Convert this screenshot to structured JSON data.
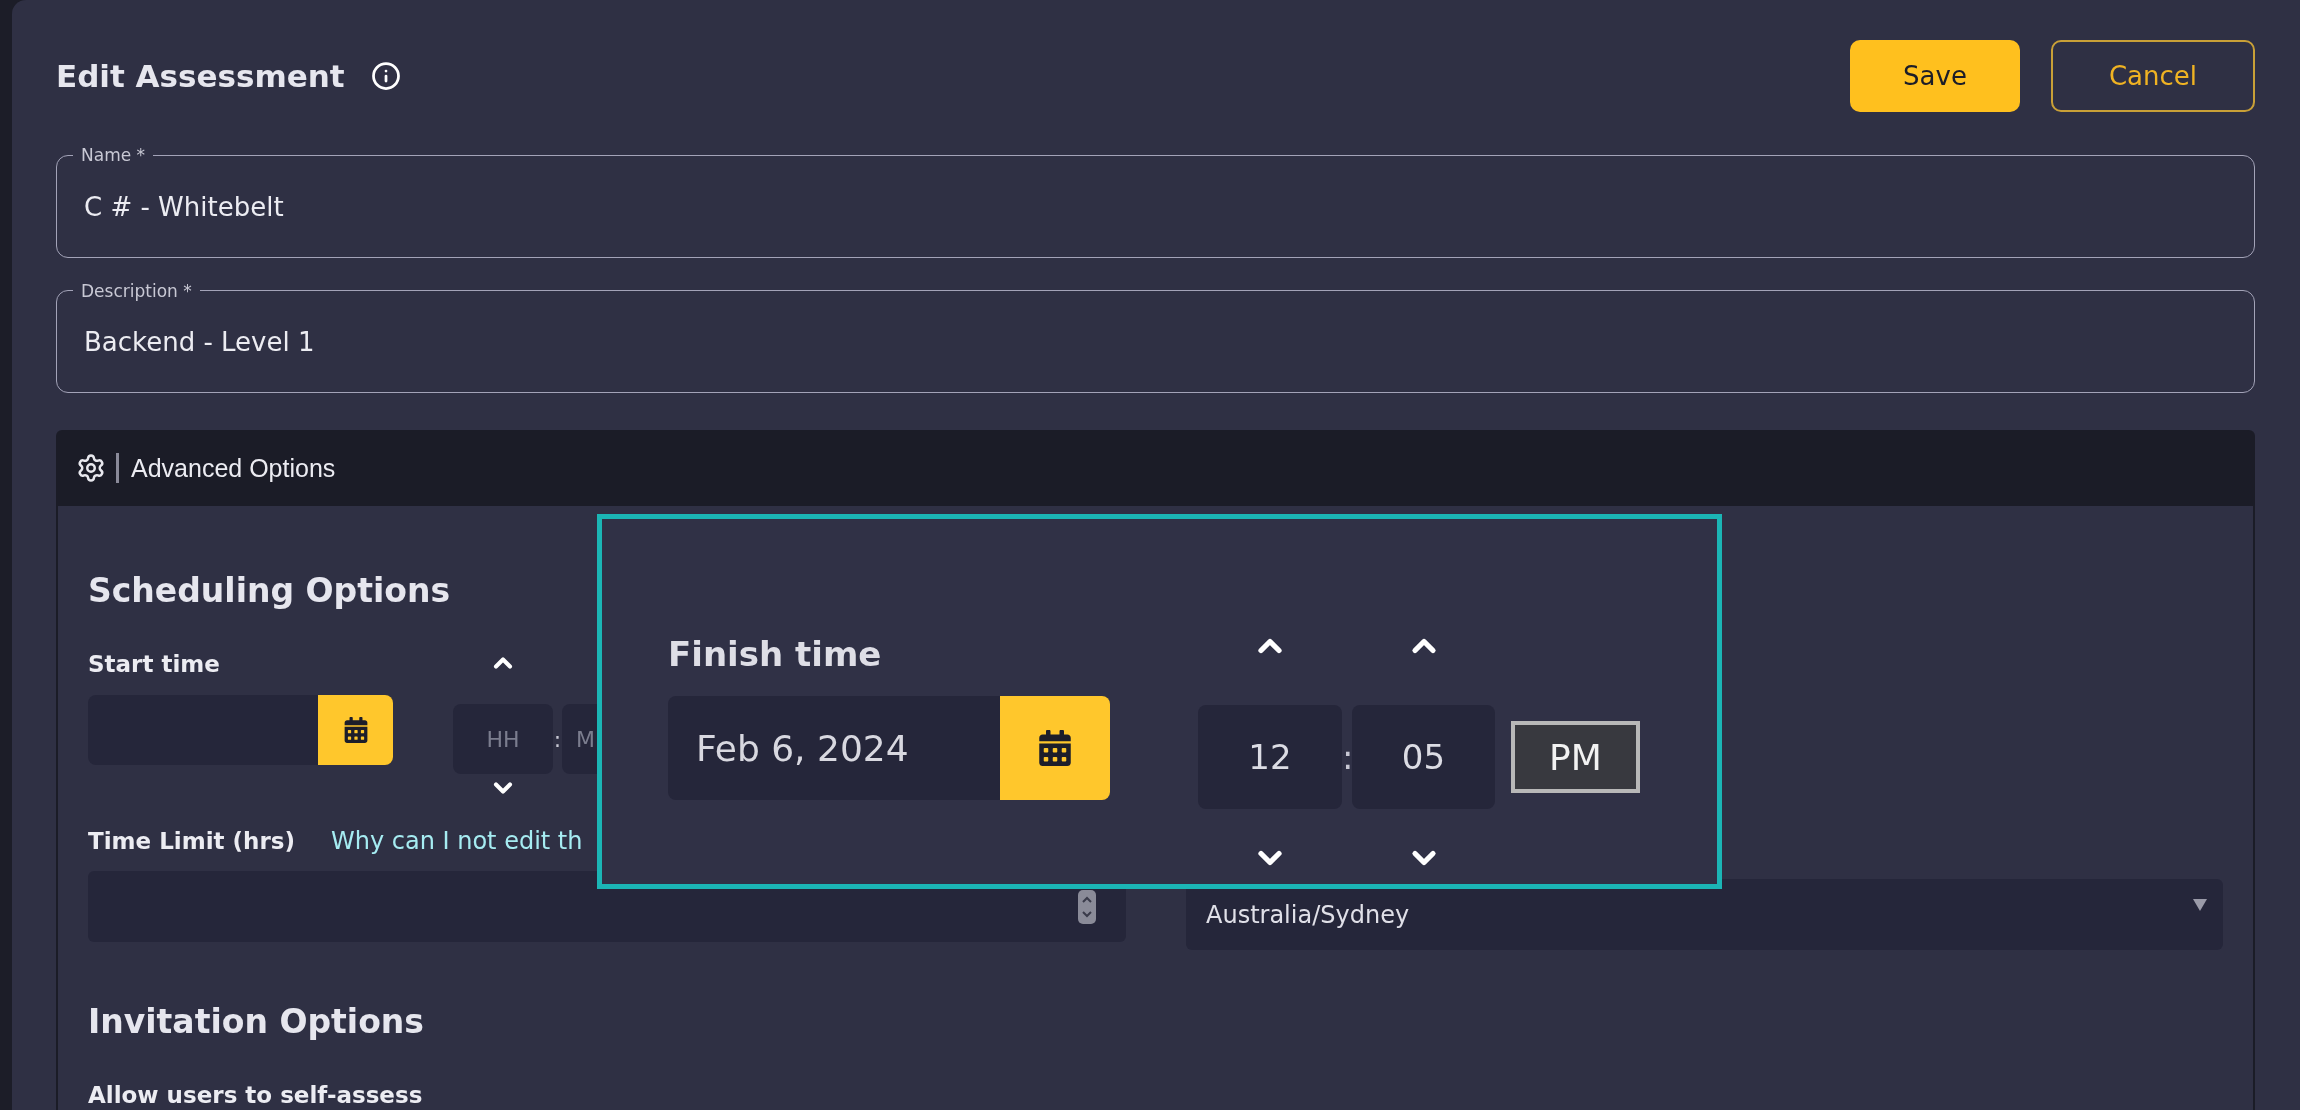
{
  "header": {
    "title": "Edit Assessment",
    "buttons": [
      {
        "label": "Save",
        "kind": "primary"
      },
      {
        "label": "Cancel",
        "kind": "secondary"
      }
    ]
  },
  "fields": [
    {
      "label": "Name *",
      "value": "C # - Whitebelt"
    },
    {
      "label": "Description *",
      "value": "Backend - Level 1"
    }
  ],
  "advanced_options": {
    "title": "Advanced Options"
  },
  "scheduling": {
    "heading": "Scheduling Options",
    "start_time": {
      "label": "Start time",
      "hour_placeholder": "HH",
      "separator": ":",
      "minute_placeholder": "M"
    },
    "time_limit": {
      "label": "Time Limit (hrs)",
      "help_link": "Why can I not edit th"
    },
    "timezone": {
      "value": "Australia/Sydney"
    }
  },
  "invitation": {
    "heading": "Invitation Options",
    "self_assess_label": "Allow users to self-assess"
  },
  "callout": {
    "label": "Finish time",
    "date": "Feb 6, 2024",
    "hour": "12",
    "separator": ":",
    "minute": "05",
    "period": "PM"
  }
}
